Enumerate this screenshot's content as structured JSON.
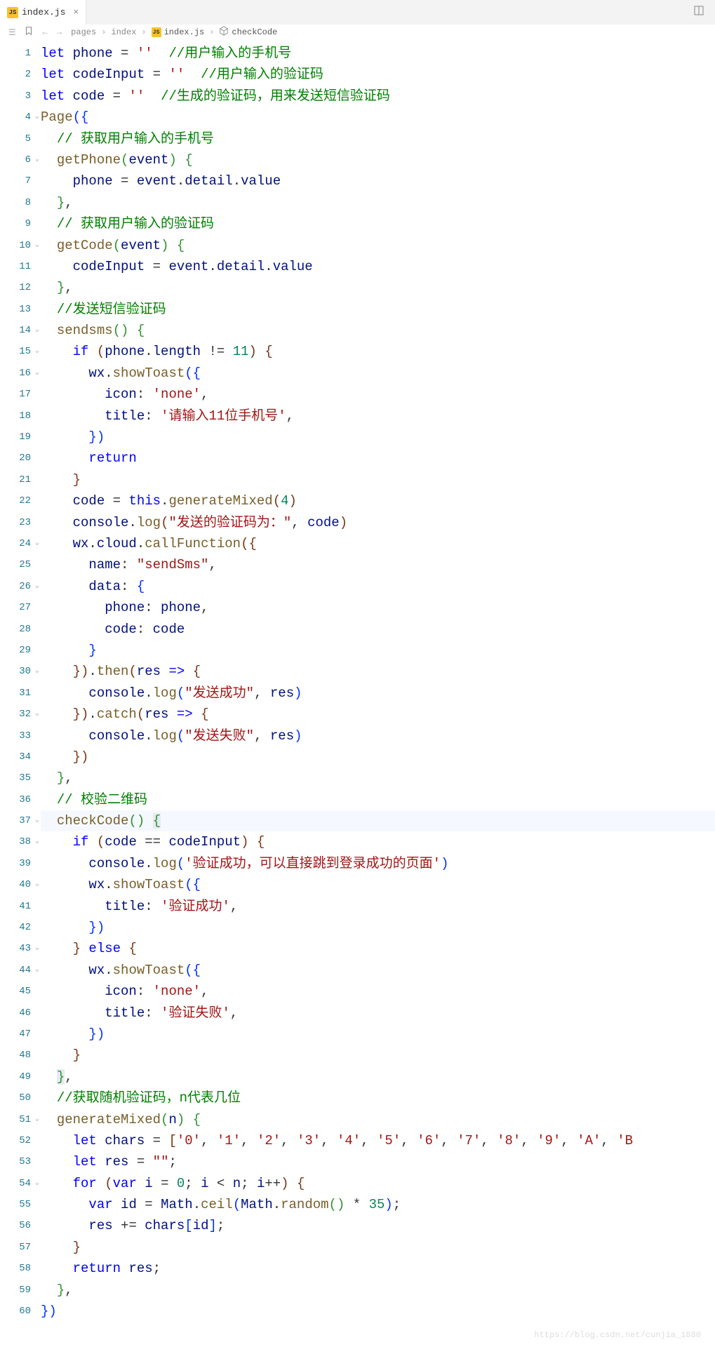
{
  "tab": {
    "filename": "index.js"
  },
  "breadcrumb": {
    "path1": "pages",
    "path2": "index",
    "file": "index.js",
    "symbol": "checkCode"
  },
  "icons": {
    "chevron": "›",
    "close": "×",
    "back": "←",
    "forward": "→"
  },
  "gutter": {
    "lines": [
      {
        "n": "1"
      },
      {
        "n": "2"
      },
      {
        "n": "3"
      },
      {
        "n": "4",
        "f": true
      },
      {
        "n": "5"
      },
      {
        "n": "6",
        "f": true
      },
      {
        "n": "7"
      },
      {
        "n": "8"
      },
      {
        "n": "9"
      },
      {
        "n": "10",
        "f": true
      },
      {
        "n": "11"
      },
      {
        "n": "12"
      },
      {
        "n": "13"
      },
      {
        "n": "14",
        "f": true
      },
      {
        "n": "15",
        "f": true
      },
      {
        "n": "16",
        "f": true
      },
      {
        "n": "17"
      },
      {
        "n": "18"
      },
      {
        "n": "19"
      },
      {
        "n": "20"
      },
      {
        "n": "21"
      },
      {
        "n": "22"
      },
      {
        "n": "23"
      },
      {
        "n": "24",
        "f": true
      },
      {
        "n": "25"
      },
      {
        "n": "26",
        "f": true
      },
      {
        "n": "27"
      },
      {
        "n": "28"
      },
      {
        "n": "29"
      },
      {
        "n": "30",
        "f": true
      },
      {
        "n": "31"
      },
      {
        "n": "32",
        "f": true
      },
      {
        "n": "33"
      },
      {
        "n": "34"
      },
      {
        "n": "35"
      },
      {
        "n": "36"
      },
      {
        "n": "37",
        "f": true
      },
      {
        "n": "38",
        "f": true
      },
      {
        "n": "39"
      },
      {
        "n": "40",
        "f": true
      },
      {
        "n": "41"
      },
      {
        "n": "42"
      },
      {
        "n": "43",
        "f": true
      },
      {
        "n": "44",
        "f": true
      },
      {
        "n": "45"
      },
      {
        "n": "46"
      },
      {
        "n": "47"
      },
      {
        "n": "48"
      },
      {
        "n": "49"
      },
      {
        "n": "50"
      },
      {
        "n": "51",
        "f": true
      },
      {
        "n": "52"
      },
      {
        "n": "53"
      },
      {
        "n": "54",
        "f": true
      },
      {
        "n": "55"
      },
      {
        "n": "56"
      },
      {
        "n": "57"
      },
      {
        "n": "58"
      },
      {
        "n": "59"
      },
      {
        "n": "60"
      }
    ]
  },
  "code": [
    {
      "html": "<span class='kw'>let</span> <span class='vn'>phone</span> = <span class='str'>''</span>  <span class='cm'>//用户输入的手机号</span>"
    },
    {
      "html": "<span class='kw'>let</span> <span class='vn'>codeInput</span> = <span class='str'>''</span>  <span class='cm'>//用户输入的验证码</span>"
    },
    {
      "html": "<span class='kw'>let</span> <span class='vn'>code</span> = <span class='str'>''</span>  <span class='cm'>//生成的验证码，用来发送短信验证码</span>"
    },
    {
      "html": "<span class='fn'>Page</span><span class='pn'>(</span><span class='pn'>{</span>"
    },
    {
      "html": "  <span class='cm'>// 获取用户输入的手机号</span>"
    },
    {
      "html": "  <span class='fn'>getPhone</span><span class='py'>(</span><span class='vn'>event</span><span class='py'>)</span> <span class='py'>{</span>"
    },
    {
      "html": "    <span class='vn'>phone</span> = <span class='vn'>event</span>.<span class='vn'>detail</span>.<span class='vn'>value</span>"
    },
    {
      "html": "  <span class='py'>}</span>,"
    },
    {
      "html": "  <span class='cm'>// 获取用户输入的验证码</span>"
    },
    {
      "html": "  <span class='fn'>getCode</span><span class='py'>(</span><span class='vn'>event</span><span class='py'>)</span> <span class='py'>{</span>"
    },
    {
      "html": "    <span class='vn'>codeInput</span> = <span class='vn'>event</span>.<span class='vn'>detail</span>.<span class='vn'>value</span>"
    },
    {
      "html": "  <span class='py'>}</span>,"
    },
    {
      "html": "  <span class='cm'>//发送短信验证码</span>"
    },
    {
      "html": "  <span class='fn'>sendsms</span><span class='py'>(</span><span class='py'>)</span> <span class='py'>{</span>"
    },
    {
      "html": "    <span class='kw'>if</span> <span class='pp'>(</span><span class='vn'>phone</span>.<span class='vn'>length</span> != <span class='num'>11</span><span class='pp'>)</span> <span class='pp'>{</span>"
    },
    {
      "html": "      <span class='vn'>wx</span>.<span class='fn'>showToast</span><span class='pn'>(</span><span class='pn'>{</span>"
    },
    {
      "html": "        <span class='vn'>icon</span>: <span class='str'>'none'</span>,"
    },
    {
      "html": "        <span class='vn'>title</span>: <span class='str'>'请输入11位手机号'</span>,"
    },
    {
      "html": "      <span class='pn'>}</span><span class='pn'>)</span>"
    },
    {
      "html": "      <span class='kw'>return</span>"
    },
    {
      "html": "    <span class='pp'>}</span>"
    },
    {
      "html": "    <span class='vn'>code</span> = <span class='kw'>this</span>.<span class='fn'>generateMixed</span><span class='pp'>(</span><span class='num'>4</span><span class='pp'>)</span>"
    },
    {
      "html": "    <span class='vn'>console</span>.<span class='fn'>log</span><span class='pp'>(</span><span class='str'>\"发送的验证码为：\"</span>, <span class='vn'>code</span><span class='pp'>)</span>"
    },
    {
      "html": "    <span class='vn'>wx</span>.<span class='vn'>cloud</span>.<span class='fn'>callFunction</span><span class='pp'>(</span><span class='pp'>{</span>"
    },
    {
      "html": "      <span class='vn'>name</span>: <span class='str'>\"sendSms\"</span>,"
    },
    {
      "html": "      <span class='vn'>data</span>: <span class='pn'>{</span>"
    },
    {
      "html": "        <span class='vn'>phone</span>: <span class='vn'>phone</span>,"
    },
    {
      "html": "        <span class='vn'>code</span>: <span class='vn'>code</span>"
    },
    {
      "html": "      <span class='pn'>}</span>"
    },
    {
      "html": "    <span class='pp'>}</span><span class='pp'>)</span>.<span class='fn'>then</span><span class='pp'>(</span><span class='vn'>res</span> <span class='kw'>=&gt;</span> <span class='pp'>{</span>"
    },
    {
      "html": "      <span class='vn'>console</span>.<span class='fn'>log</span><span class='pn'>(</span><span class='str'>\"发送成功\"</span>, <span class='vn'>res</span><span class='pn'>)</span>"
    },
    {
      "html": "    <span class='pp'>}</span><span class='pp'>)</span>.<span class='fn'>catch</span><span class='pp'>(</span><span class='vn'>res</span> <span class='kw'>=&gt;</span> <span class='pp'>{</span>"
    },
    {
      "html": "      <span class='vn'>console</span>.<span class='fn'>log</span><span class='pn'>(</span><span class='str'>\"发送失败\"</span>, <span class='vn'>res</span><span class='pn'>)</span>"
    },
    {
      "html": "    <span class='pp'>}</span><span class='pp'>)</span>"
    },
    {
      "html": "  <span class='py'>}</span>,"
    },
    {
      "html": "  <span class='cm'>// 校验二维码</span>"
    },
    {
      "html": "  <span class='fn'>checkCode</span><span class='py'>(</span><span class='py'>)</span> <span class='py matched'>{</span>",
      "hl": true
    },
    {
      "html": "    <span class='kw'>if</span> <span class='pp'>(</span><span class='vn'>code</span> == <span class='vn'>codeInput</span><span class='pp'>)</span> <span class='pp'>{</span>"
    },
    {
      "html": "      <span class='vn'>console</span>.<span class='fn'>log</span><span class='pn'>(</span><span class='str'>'验证成功，可以直接跳到登录成功的页面'</span><span class='pn'>)</span>"
    },
    {
      "html": "      <span class='vn'>wx</span>.<span class='fn'>showToast</span><span class='pn'>(</span><span class='pn'>{</span>"
    },
    {
      "html": "        <span class='vn'>title</span>: <span class='str'>'验证成功'</span>,"
    },
    {
      "html": "      <span class='pn'>}</span><span class='pn'>)</span>"
    },
    {
      "html": "    <span class='pp'>}</span> <span class='kw'>else</span> <span class='pp'>{</span>"
    },
    {
      "html": "      <span class='vn'>wx</span>.<span class='fn'>showToast</span><span class='pn'>(</span><span class='pn'>{</span>"
    },
    {
      "html": "        <span class='vn'>icon</span>: <span class='str'>'none'</span>,"
    },
    {
      "html": "        <span class='vn'>title</span>: <span class='str'>'验证失败'</span>,"
    },
    {
      "html": "      <span class='pn'>}</span><span class='pn'>)</span>"
    },
    {
      "html": "    <span class='pp'>}</span>"
    },
    {
      "html": "  <span class='py matched'>}</span>,"
    },
    {
      "html": "  <span class='cm'>//获取随机验证码，n代表几位</span>"
    },
    {
      "html": "  <span class='fn'>generateMixed</span><span class='py'>(</span><span class='vn'>n</span><span class='py'>)</span> <span class='py'>{</span>"
    },
    {
      "html": "    <span class='kw'>let</span> <span class='vn'>chars</span> = <span class='pp'>[</span><span class='str'>'0'</span>, <span class='str'>'1'</span>, <span class='str'>'2'</span>, <span class='str'>'3'</span>, <span class='str'>'4'</span>, <span class='str'>'5'</span>, <span class='str'>'6'</span>, <span class='str'>'7'</span>, <span class='str'>'8'</span>, <span class='str'>'9'</span>, <span class='str'>'A'</span>, <span class='str'>'B</span>"
    },
    {
      "html": "    <span class='kw'>let</span> <span class='vn'>res</span> = <span class='str'>\"\"</span>;"
    },
    {
      "html": "    <span class='kw'>for</span> <span class='pp'>(</span><span class='kw'>var</span> <span class='vn'>i</span> = <span class='num'>0</span>; <span class='vn'>i</span> &lt; <span class='vn'>n</span>; <span class='vn'>i</span>++<span class='pp'>)</span> <span class='pp'>{</span>"
    },
    {
      "html": "      <span class='kw'>var</span> <span class='vn'>id</span> = <span class='vn'>Math</span>.<span class='fn'>ceil</span><span class='pn'>(</span><span class='vn'>Math</span>.<span class='fn'>random</span><span class='py'>(</span><span class='py'>)</span> * <span class='num'>35</span><span class='pn'>)</span>;"
    },
    {
      "html": "      <span class='vn'>res</span> += <span class='vn'>chars</span><span class='pn'>[</span><span class='vn'>id</span><span class='pn'>]</span>;"
    },
    {
      "html": "    <span class='pp'>}</span>"
    },
    {
      "html": "    <span class='kw'>return</span> <span class='vn'>res</span>;"
    },
    {
      "html": "  <span class='py'>}</span>,"
    },
    {
      "html": "<span class='pn'>}</span><span class='pn'>)</span>"
    }
  ],
  "watermark": "https://blog.csdn.net/cunjia_1880"
}
